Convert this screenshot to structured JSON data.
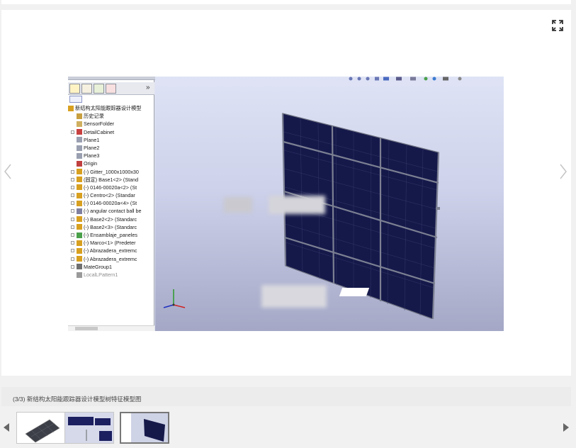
{
  "viewer": {
    "fullscreen_icon": "expand-arrows-icon",
    "prev_icon": "chevron-left-icon",
    "next_icon": "chevron-right-icon"
  },
  "cad": {
    "panel_tabs": [
      "feature-manager-icon",
      "property-manager-icon",
      "configuration-manager-icon",
      "display-manager-icon"
    ],
    "panel_chevron": "»",
    "tree": [
      {
        "label": "新结构太阳能跟踪器设计模型",
        "icon": "assembly-icon",
        "indent": 0,
        "expander": false
      },
      {
        "label": "历史记录",
        "icon": "history-icon",
        "indent": 1,
        "expander": false
      },
      {
        "label": "SensorFolder",
        "icon": "sensor-icon",
        "indent": 1,
        "expander": false
      },
      {
        "label": "DetailCabinet",
        "icon": "annotation-icon",
        "indent": 1,
        "expander": true
      },
      {
        "label": "Plane1",
        "icon": "plane-icon",
        "indent": 1,
        "expander": false
      },
      {
        "label": "Plane2",
        "icon": "plane-icon",
        "indent": 1,
        "expander": false
      },
      {
        "label": "Plane3",
        "icon": "plane-icon",
        "indent": 1,
        "expander": false
      },
      {
        "label": "Origin",
        "icon": "origin-icon",
        "indent": 1,
        "expander": false
      },
      {
        "label": "(-) Gitter_1000x1000x30",
        "icon": "part-icon",
        "indent": 1,
        "expander": true
      },
      {
        "label": "(固定) Base1<2> (Stand",
        "icon": "part-icon",
        "indent": 1,
        "expander": true
      },
      {
        "label": "(-) 0146-00020a<2> (St",
        "icon": "part-icon",
        "indent": 1,
        "expander": true
      },
      {
        "label": "(-) Centro<2> (Standar",
        "icon": "part-icon",
        "indent": 1,
        "expander": true
      },
      {
        "label": "(-) 0146-00020a<4> (St",
        "icon": "part-icon",
        "indent": 1,
        "expander": true
      },
      {
        "label": "(-) angular contact ball be",
        "icon": "bearing-icon",
        "indent": 1,
        "expander": true
      },
      {
        "label": "(-) Base2<2> (Standarc",
        "icon": "part-icon",
        "indent": 1,
        "expander": true
      },
      {
        "label": "(-) Base2<3> (Standarc",
        "icon": "part-icon",
        "indent": 1,
        "expander": true
      },
      {
        "label": "(-) Ensamblaje_paneles",
        "icon": "subassembly-icon",
        "indent": 1,
        "expander": true
      },
      {
        "label": "(-) Marco<1> (Predeter",
        "icon": "part-icon",
        "indent": 1,
        "expander": true
      },
      {
        "label": "(-) Abrazadera_extremc",
        "icon": "part-icon",
        "indent": 1,
        "expander": true
      },
      {
        "label": "(-) Abrazadera_extremc",
        "icon": "part-icon",
        "indent": 1,
        "expander": true
      },
      {
        "label": "MateGroup1",
        "icon": "mate-icon",
        "indent": 1,
        "expander": true
      },
      {
        "label": "LocalLPattern1",
        "icon": "pattern-icon",
        "indent": 1,
        "expander": false,
        "dim": true
      }
    ]
  },
  "caption": {
    "text": "(3/3) 新结构太阳能跟踪器设计模型树特征模型图"
  },
  "thumbnails": [
    {
      "name": "thumbnail-1",
      "active": false
    },
    {
      "name": "thumbnail-2",
      "active": false
    },
    {
      "name": "thumbnail-3",
      "active": true
    }
  ],
  "colors": {
    "panel_cell": "#15194a",
    "frame": "#6e7180",
    "viewport_top": "#dfe3f5",
    "viewport_bottom": "#a4a8c6"
  }
}
